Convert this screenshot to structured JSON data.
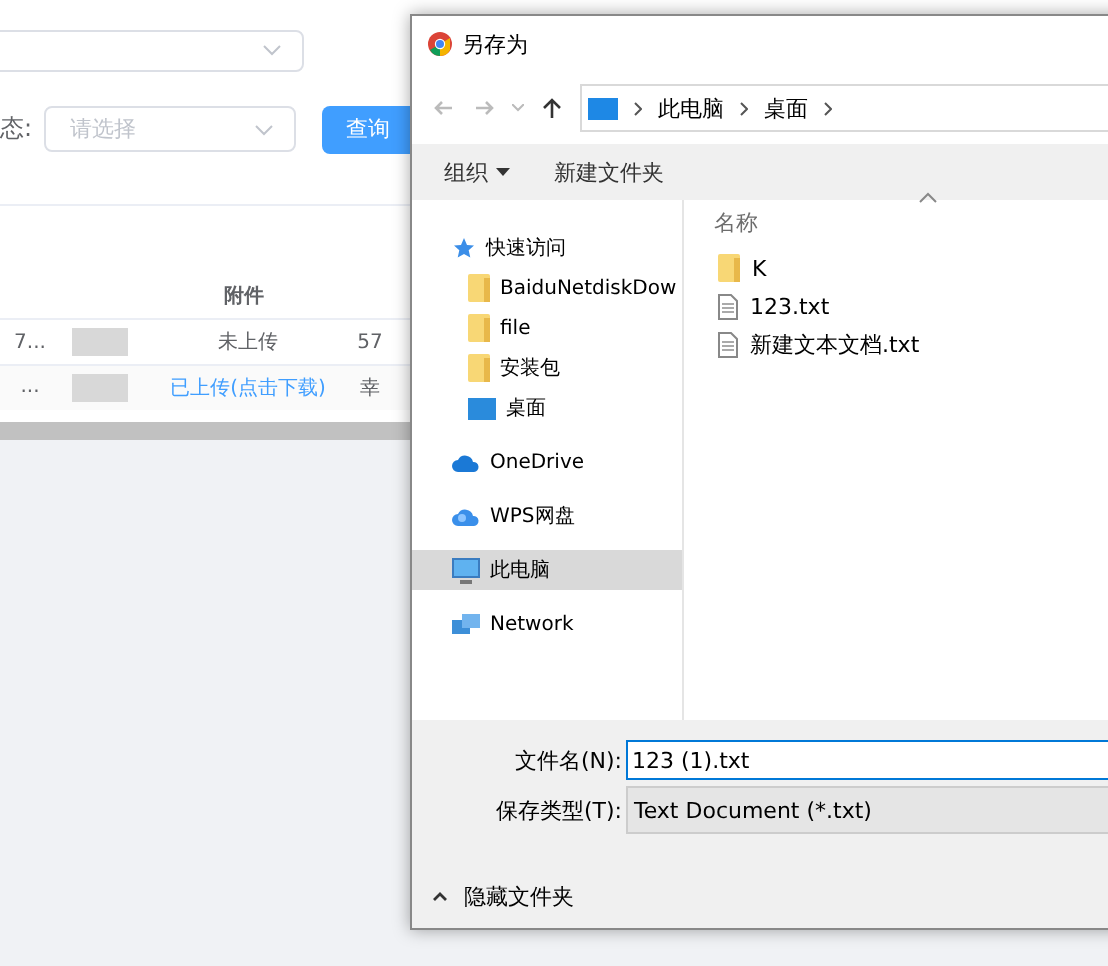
{
  "background_page": {
    "filters": {
      "label": "态:",
      "select_placeholder": "请选择",
      "query_button": "查询"
    },
    "table": {
      "column_header": "附件",
      "rows": [
        {
          "column_1": "7...",
          "attachment": "未上传",
          "attachment_link": false,
          "column_4": "57"
        },
        {
          "column_1": "...",
          "attachment": "已上传(点击下载)",
          "attachment_link": true,
          "column_4": "幸"
        }
      ]
    }
  },
  "dialog": {
    "title": "另存为",
    "breadcrumb": [
      "此电脑",
      "桌面"
    ],
    "toolbar": {
      "organize": "组织",
      "new_folder": "新建文件夹"
    },
    "nav": [
      {
        "label": "快速访问",
        "kind": "star",
        "selected": false,
        "children": [
          {
            "label": "BaiduNetdiskDow",
            "kind": "folder",
            "selected": false
          },
          {
            "label": "file",
            "kind": "folder",
            "selected": false
          },
          {
            "label": "安装包",
            "kind": "folder",
            "selected": false
          },
          {
            "label": "桌面",
            "kind": "desktop",
            "selected": false
          }
        ]
      },
      {
        "label": "OneDrive",
        "kind": "cloud",
        "selected": false
      },
      {
        "label": "WPS网盘",
        "kind": "cloud2",
        "selected": false
      },
      {
        "label": "此电脑",
        "kind": "pc",
        "selected": true
      },
      {
        "label": "Network",
        "kind": "network",
        "selected": false
      }
    ],
    "files_header": "名称",
    "files": [
      {
        "name": "K",
        "kind": "folder"
      },
      {
        "name": "123.txt",
        "kind": "file"
      },
      {
        "name": "新建文本文档.txt",
        "kind": "file"
      }
    ],
    "filename_label": "文件名(N):",
    "filename_value": "123 (1).txt",
    "filetype_label": "保存类型(T):",
    "filetype_value": "Text Document (*.txt)",
    "hide_folders": "隐藏文件夹"
  }
}
